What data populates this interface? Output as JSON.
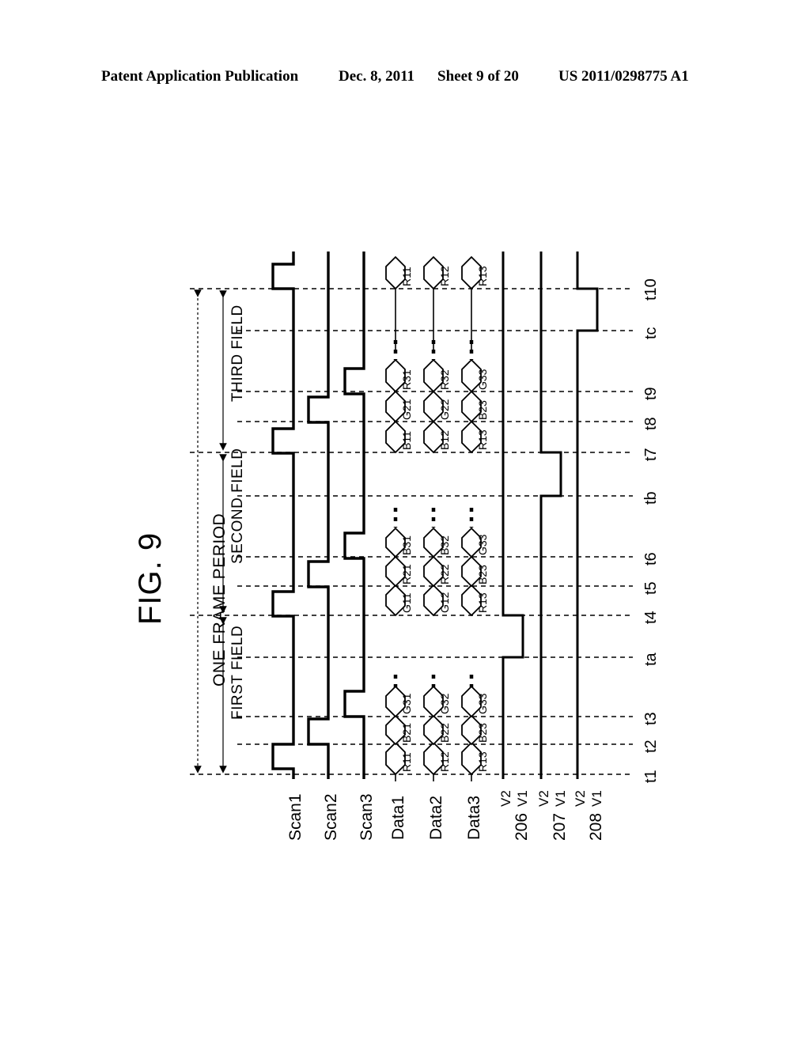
{
  "header": {
    "publication": "Patent Application Publication",
    "date": "Dec. 8, 2011",
    "sheet": "Sheet 9 of 20",
    "number": "US 2011/0298775 A1"
  },
  "figure": {
    "title": "FIG. 9",
    "frame_label": "ONE FRAME PERIOD",
    "fields": [
      {
        "label": "FIRST FIELD",
        "start_time": "t1",
        "end_time": "t4"
      },
      {
        "label": "SECOND FIELD",
        "start_time": "t4",
        "end_time": "t7"
      },
      {
        "label": "THIRD FIELD",
        "start_time": "t7",
        "end_time": "t10"
      }
    ],
    "time_axis": {
      "ticks": [
        "t1",
        "t2",
        "t3",
        "ta",
        "t4",
        "t5",
        "t6",
        "tb",
        "t7",
        "t8",
        "t9",
        "tc",
        "t10"
      ]
    },
    "signals": [
      {
        "name": "Scan1",
        "sub_labels": []
      },
      {
        "name": "Scan2",
        "sub_labels": []
      },
      {
        "name": "Scan3",
        "sub_labels": []
      },
      {
        "name": "Data1",
        "sub_labels": []
      },
      {
        "name": "Data2",
        "sub_labels": []
      },
      {
        "name": "Data3",
        "sub_labels": []
      },
      {
        "name": "206",
        "sub_labels": [
          "V2",
          "V1"
        ]
      },
      {
        "name": "207",
        "sub_labels": [
          "V2",
          "V1"
        ]
      },
      {
        "name": "208",
        "sub_labels": [
          "V2",
          "V1"
        ]
      }
    ],
    "data_values": {
      "Data1": {
        "first_field": [
          "R11",
          "B21",
          "G31"
        ],
        "second_field": [
          "G11",
          "R21",
          "B31"
        ],
        "third_field": [
          "B11",
          "G21",
          "R31"
        ],
        "top": "R11"
      },
      "Data2": {
        "first_field": [
          "R12",
          "B22",
          "G32"
        ],
        "second_field": [
          "G12",
          "R22",
          "B32"
        ],
        "third_field": [
          "B12",
          "G22",
          "R32"
        ],
        "top": "R12"
      },
      "Data3": {
        "first_field": [
          "R13",
          "B23",
          "G33"
        ],
        "second_field": [
          "R13",
          "B23",
          "G33"
        ],
        "third_field": [
          "R13",
          "B23",
          "G33"
        ],
        "top": "R13"
      }
    },
    "colors": {
      "stroke": "#000000",
      "background": "#ffffff"
    }
  }
}
